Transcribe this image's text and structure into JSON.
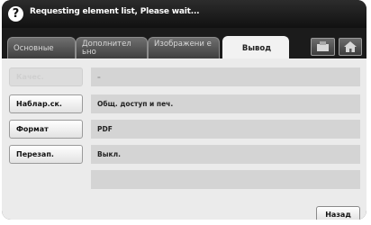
{
  "header": {
    "help_symbol": "?",
    "status": "Requesting element list, Please wait..."
  },
  "tabs": [
    {
      "label": "Основные",
      "active": false
    },
    {
      "label": "Дополнител ьно",
      "active": false
    },
    {
      "label": "Изображени е",
      "active": false
    },
    {
      "label": "Вывод",
      "active": true
    }
  ],
  "toolbar_icons": [
    "job-status-icon",
    "home-icon"
  ],
  "settings": [
    {
      "label": "Качес.",
      "value": "–",
      "enabled": false
    },
    {
      "label": "Наблар.ск.",
      "value": "Общ. доступ и печ.",
      "enabled": true
    },
    {
      "label": "Формат",
      "value": "PDF",
      "enabled": true
    },
    {
      "label": "Перезап.",
      "value": "Выкл.",
      "enabled": true
    }
  ],
  "footer": {
    "back_label": "Назад"
  },
  "colors": {
    "title_bar": "#1b1b1b",
    "panel": "#ebebeb",
    "field": "#d4d4d4"
  }
}
